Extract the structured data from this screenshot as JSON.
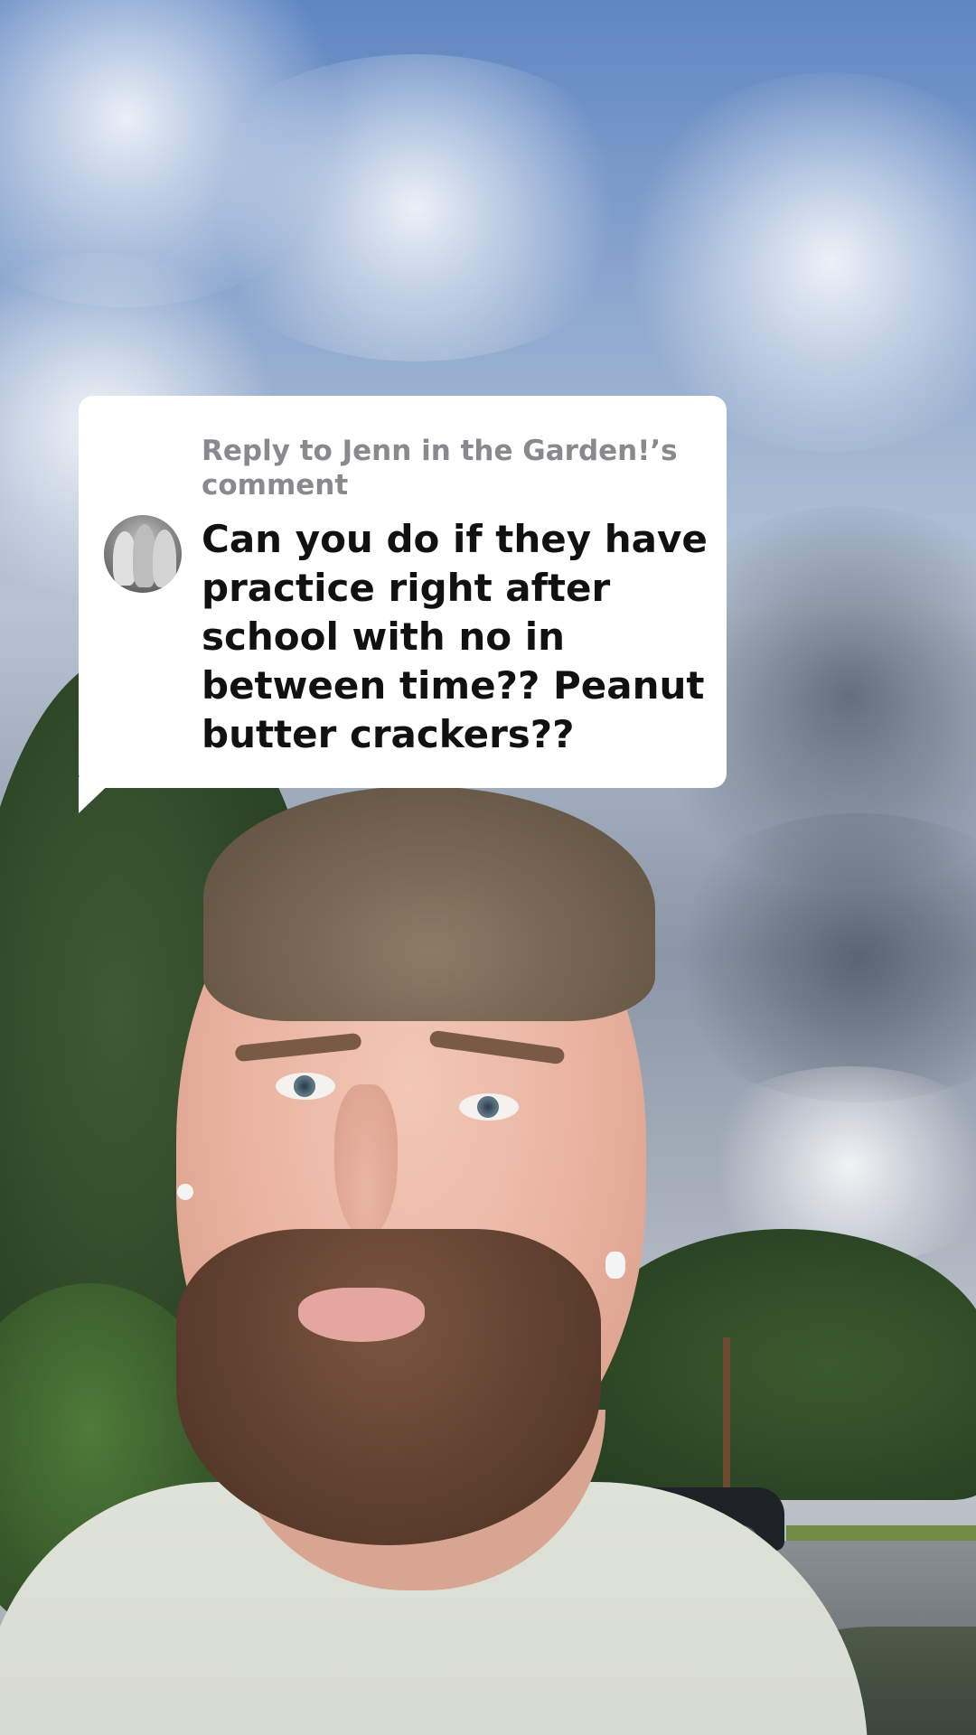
{
  "comment_reply": {
    "header": "Reply to Jenn in the Garden!’s comment",
    "comment_text": "Can you do if they have practice right after school with no in between time?? Peanut butter crackers??",
    "avatar_icon": "commenter-avatar"
  }
}
